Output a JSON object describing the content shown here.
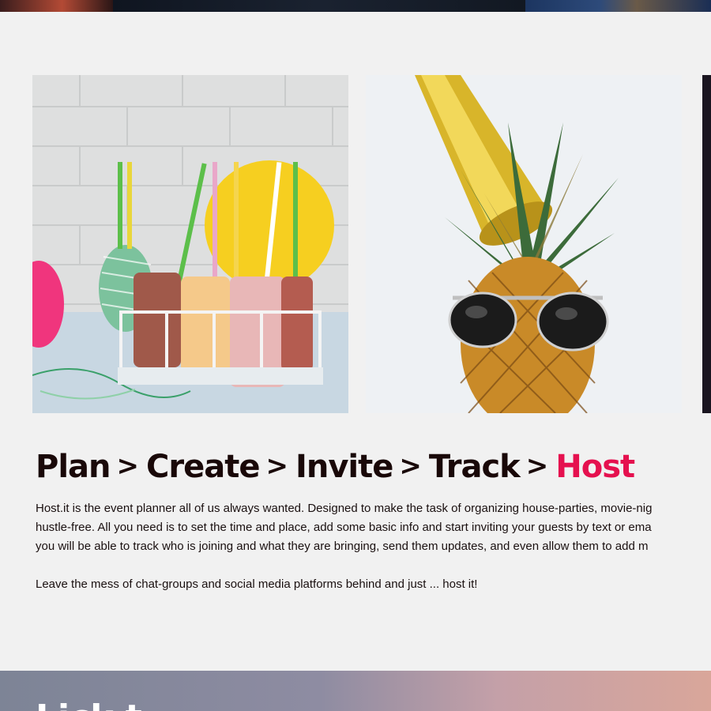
{
  "headline": {
    "steps": [
      "Plan",
      "Create",
      "Invite",
      "Track"
    ],
    "separator": ">",
    "highlight": "Host"
  },
  "description": {
    "lines": [
      "Host.it is the event planner all of us always wanted. Designed to make the task of organizing house-parties, movie-nig",
      "hustle-free. All you need is to set the time and place, add some basic info and start inviting your guests by text or ema",
      "you will be able to track who is joining and what they are bringing, send them updates, and even allow them to add m"
    ],
    "tagline": "Leave the mess of chat-groups and social media platforms behind and just ... host it!"
  },
  "bottom_section": {
    "heading": "Lick t"
  },
  "colors": {
    "accent": "#e5114f",
    "text": "#190808",
    "background": "#f1f1f1"
  }
}
